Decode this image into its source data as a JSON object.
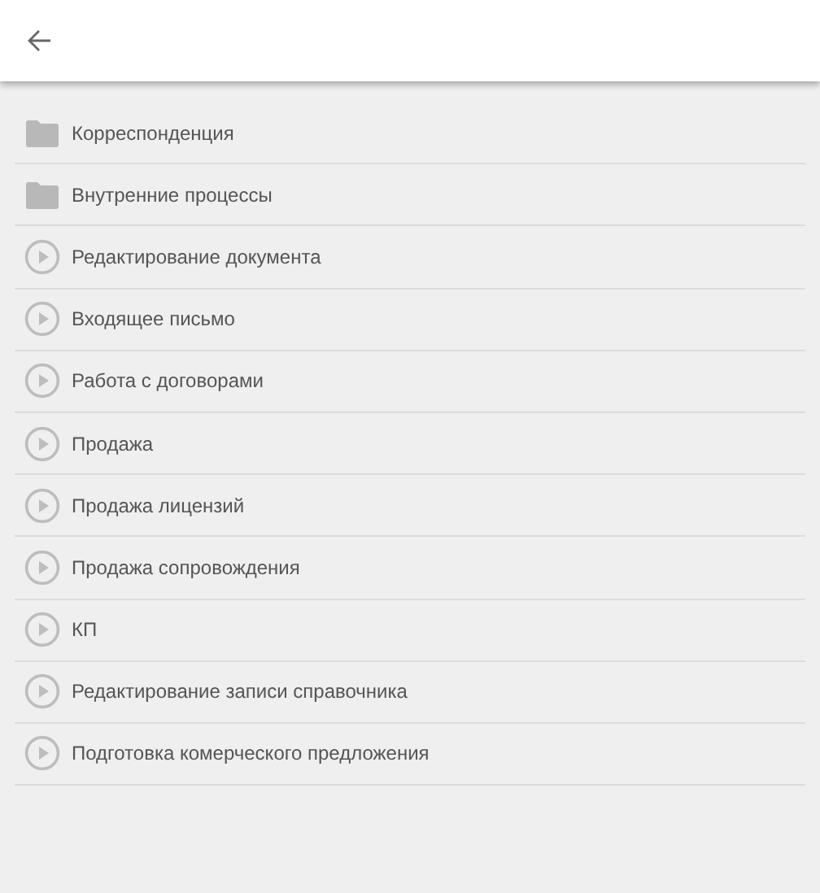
{
  "header": {
    "back_icon": true
  },
  "items": [
    {
      "kind": "folder",
      "label": "Корреспонденция"
    },
    {
      "kind": "folder",
      "label": "Внутренние процессы"
    },
    {
      "kind": "process",
      "label": "Редактирование документа"
    },
    {
      "kind": "process",
      "label": "Входящее письмо"
    },
    {
      "kind": "process",
      "label": "Работа с договорами"
    },
    {
      "kind": "process",
      "label": "Продажа"
    },
    {
      "kind": "process",
      "label": "Продажа лицензий"
    },
    {
      "kind": "process",
      "label": "Продажа сопровождения"
    },
    {
      "kind": "process",
      "label": "КП"
    },
    {
      "kind": "process",
      "label": "Редактирование записи справочника"
    },
    {
      "kind": "process",
      "label": "Подготовка комерческого предложения"
    }
  ]
}
